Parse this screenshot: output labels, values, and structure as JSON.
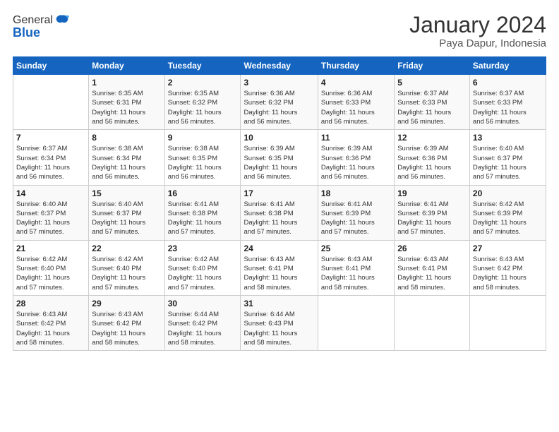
{
  "logo": {
    "line1": "General",
    "line2": "Blue"
  },
  "title": "January 2024",
  "location": "Paya Dapur, Indonesia",
  "days_header": [
    "Sunday",
    "Monday",
    "Tuesday",
    "Wednesday",
    "Thursday",
    "Friday",
    "Saturday"
  ],
  "weeks": [
    [
      {
        "num": "",
        "info": ""
      },
      {
        "num": "1",
        "info": "Sunrise: 6:35 AM\nSunset: 6:31 PM\nDaylight: 11 hours\nand 56 minutes."
      },
      {
        "num": "2",
        "info": "Sunrise: 6:35 AM\nSunset: 6:32 PM\nDaylight: 11 hours\nand 56 minutes."
      },
      {
        "num": "3",
        "info": "Sunrise: 6:36 AM\nSunset: 6:32 PM\nDaylight: 11 hours\nand 56 minutes."
      },
      {
        "num": "4",
        "info": "Sunrise: 6:36 AM\nSunset: 6:33 PM\nDaylight: 11 hours\nand 56 minutes."
      },
      {
        "num": "5",
        "info": "Sunrise: 6:37 AM\nSunset: 6:33 PM\nDaylight: 11 hours\nand 56 minutes."
      },
      {
        "num": "6",
        "info": "Sunrise: 6:37 AM\nSunset: 6:33 PM\nDaylight: 11 hours\nand 56 minutes."
      }
    ],
    [
      {
        "num": "7",
        "info": "Sunrise: 6:37 AM\nSunset: 6:34 PM\nDaylight: 11 hours\nand 56 minutes."
      },
      {
        "num": "8",
        "info": "Sunrise: 6:38 AM\nSunset: 6:34 PM\nDaylight: 11 hours\nand 56 minutes."
      },
      {
        "num": "9",
        "info": "Sunrise: 6:38 AM\nSunset: 6:35 PM\nDaylight: 11 hours\nand 56 minutes."
      },
      {
        "num": "10",
        "info": "Sunrise: 6:39 AM\nSunset: 6:35 PM\nDaylight: 11 hours\nand 56 minutes."
      },
      {
        "num": "11",
        "info": "Sunrise: 6:39 AM\nSunset: 6:36 PM\nDaylight: 11 hours\nand 56 minutes."
      },
      {
        "num": "12",
        "info": "Sunrise: 6:39 AM\nSunset: 6:36 PM\nDaylight: 11 hours\nand 56 minutes."
      },
      {
        "num": "13",
        "info": "Sunrise: 6:40 AM\nSunset: 6:37 PM\nDaylight: 11 hours\nand 57 minutes."
      }
    ],
    [
      {
        "num": "14",
        "info": "Sunrise: 6:40 AM\nSunset: 6:37 PM\nDaylight: 11 hours\nand 57 minutes."
      },
      {
        "num": "15",
        "info": "Sunrise: 6:40 AM\nSunset: 6:37 PM\nDaylight: 11 hours\nand 57 minutes."
      },
      {
        "num": "16",
        "info": "Sunrise: 6:41 AM\nSunset: 6:38 PM\nDaylight: 11 hours\nand 57 minutes."
      },
      {
        "num": "17",
        "info": "Sunrise: 6:41 AM\nSunset: 6:38 PM\nDaylight: 11 hours\nand 57 minutes."
      },
      {
        "num": "18",
        "info": "Sunrise: 6:41 AM\nSunset: 6:39 PM\nDaylight: 11 hours\nand 57 minutes."
      },
      {
        "num": "19",
        "info": "Sunrise: 6:41 AM\nSunset: 6:39 PM\nDaylight: 11 hours\nand 57 minutes."
      },
      {
        "num": "20",
        "info": "Sunrise: 6:42 AM\nSunset: 6:39 PM\nDaylight: 11 hours\nand 57 minutes."
      }
    ],
    [
      {
        "num": "21",
        "info": "Sunrise: 6:42 AM\nSunset: 6:40 PM\nDaylight: 11 hours\nand 57 minutes."
      },
      {
        "num": "22",
        "info": "Sunrise: 6:42 AM\nSunset: 6:40 PM\nDaylight: 11 hours\nand 57 minutes."
      },
      {
        "num": "23",
        "info": "Sunrise: 6:42 AM\nSunset: 6:40 PM\nDaylight: 11 hours\nand 57 minutes."
      },
      {
        "num": "24",
        "info": "Sunrise: 6:43 AM\nSunset: 6:41 PM\nDaylight: 11 hours\nand 58 minutes."
      },
      {
        "num": "25",
        "info": "Sunrise: 6:43 AM\nSunset: 6:41 PM\nDaylight: 11 hours\nand 58 minutes."
      },
      {
        "num": "26",
        "info": "Sunrise: 6:43 AM\nSunset: 6:41 PM\nDaylight: 11 hours\nand 58 minutes."
      },
      {
        "num": "27",
        "info": "Sunrise: 6:43 AM\nSunset: 6:42 PM\nDaylight: 11 hours\nand 58 minutes."
      }
    ],
    [
      {
        "num": "28",
        "info": "Sunrise: 6:43 AM\nSunset: 6:42 PM\nDaylight: 11 hours\nand 58 minutes."
      },
      {
        "num": "29",
        "info": "Sunrise: 6:43 AM\nSunset: 6:42 PM\nDaylight: 11 hours\nand 58 minutes."
      },
      {
        "num": "30",
        "info": "Sunrise: 6:44 AM\nSunset: 6:42 PM\nDaylight: 11 hours\nand 58 minutes."
      },
      {
        "num": "31",
        "info": "Sunrise: 6:44 AM\nSunset: 6:43 PM\nDaylight: 11 hours\nand 58 minutes."
      },
      {
        "num": "",
        "info": ""
      },
      {
        "num": "",
        "info": ""
      },
      {
        "num": "",
        "info": ""
      }
    ]
  ]
}
